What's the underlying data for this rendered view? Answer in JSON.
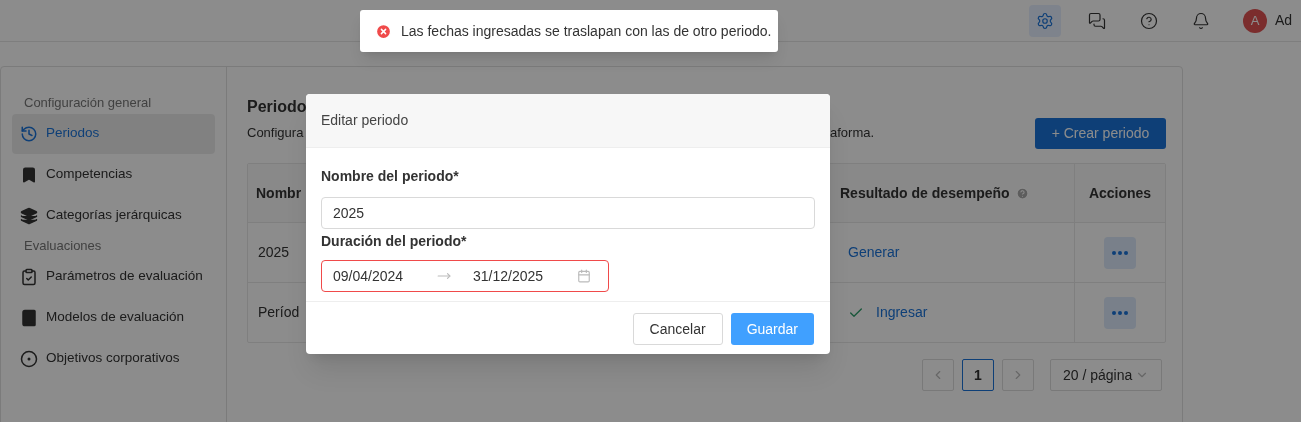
{
  "topbar": {
    "icons": [
      {
        "kind": "settings",
        "selected": true
      },
      {
        "kind": "chat",
        "selected": false
      },
      {
        "kind": "help",
        "selected": false
      },
      {
        "kind": "bell",
        "selected": false
      }
    ],
    "user": {
      "initial": "A",
      "name": "Ad"
    }
  },
  "sidebar": {
    "sections": [
      {
        "title": "Configuración general",
        "items": [
          {
            "label": "Periodos",
            "kind": "history",
            "selected": true
          },
          {
            "label": "Competencias",
            "kind": "bookmark",
            "selected": false
          },
          {
            "label": "Categorías jerárquicas",
            "kind": "layers",
            "selected": false
          }
        ]
      },
      {
        "title": "Evaluaciones",
        "items": [
          {
            "label": "Parámetros de evaluación",
            "kind": "clipboard",
            "selected": false
          },
          {
            "label": "Modelos de evaluación",
            "kind": "book",
            "selected": false
          },
          {
            "label": "Objetivos corporativos",
            "kind": "target",
            "selected": false
          }
        ]
      }
    ]
  },
  "page": {
    "title": "Periodo",
    "description_start": "Configura",
    "description_end": "aforma.",
    "create_button": "+ Crear periodo"
  },
  "table": {
    "columns": [
      {
        "label": "Nombr"
      },
      {
        "label": "Resultado de desempeño",
        "help": true
      },
      {
        "label": "Acciones",
        "help": false
      }
    ],
    "rows": [
      {
        "name": "2025",
        "result": {
          "label": "Generar",
          "done": false
        }
      },
      {
        "name": "Períod",
        "result": {
          "label": "Ingresar",
          "done": true
        }
      }
    ]
  },
  "pagination": {
    "pages": [
      {
        "label": "1",
        "selected": true
      }
    ],
    "page_size": "20 / página"
  },
  "modal": {
    "title": "Editar periodo",
    "fields": [
      {
        "kind": "text",
        "label": "Nombre del periodo*",
        "value": "2025",
        "error": false
      },
      {
        "kind": "date_range",
        "label": "Duración del periodo*",
        "start": "09/04/2024",
        "end": "31/12/2025",
        "error": true
      }
    ],
    "buttons": [
      {
        "label": "Cancelar",
        "primary": false
      },
      {
        "label": "Guardar",
        "primary": true
      }
    ]
  },
  "toast": {
    "kind": "error",
    "message": "Las fechas ingresadas se traslapan con las de otro periodo."
  }
}
